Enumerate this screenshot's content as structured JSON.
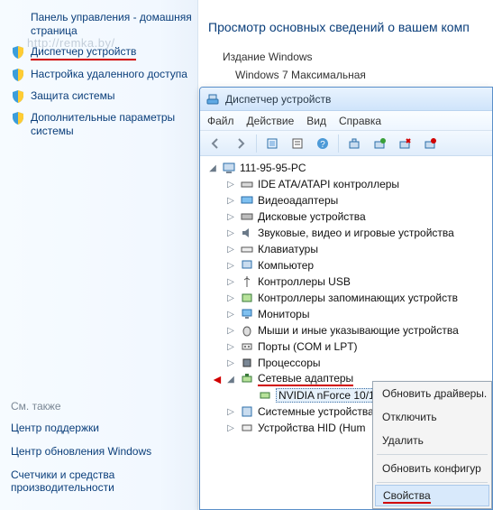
{
  "left": {
    "watermark": "http://remka.by/",
    "home": "Панель управления - домашняя страница",
    "items": [
      "Диспетчер устройств",
      "Настройка удаленного доступа",
      "Защита системы",
      "Дополнительные параметры системы"
    ],
    "see_also_header": "См. также",
    "see_also": [
      "Центр поддержки",
      "Центр обновления Windows",
      "Счетчики и средства производительности"
    ]
  },
  "right": {
    "title": "Просмотр основных сведений о вашем комп",
    "edition_label": "Издание Windows",
    "edition_value": "Windows 7 Максимальная"
  },
  "dm": {
    "title": "Диспетчер устройств",
    "menu": {
      "file": "Файл",
      "action": "Действие",
      "view": "Вид",
      "help": "Справка"
    },
    "root": "111-95-95-PC",
    "nodes": [
      "IDE ATA/ATAPI контроллеры",
      "Видеоадаптеры",
      "Дисковые устройства",
      "Звуковые, видео и игровые устройства",
      "Клавиатуры",
      "Компьютер",
      "Контроллеры USB",
      "Контроллеры запоминающих устройств",
      "Мониторы",
      "Мыши и иные указывающие устройства",
      "Порты (COM и LPT)",
      "Процессоры",
      "Сетевые адаптеры",
      "Системные устройства",
      "Устройства HID (Hum"
    ],
    "network_child": "NVIDIA nForce 10/1"
  },
  "ctx": {
    "items": [
      "Обновить драйверы.",
      "Отключить",
      "Удалить",
      "Обновить конфигур",
      "Свойства"
    ]
  }
}
